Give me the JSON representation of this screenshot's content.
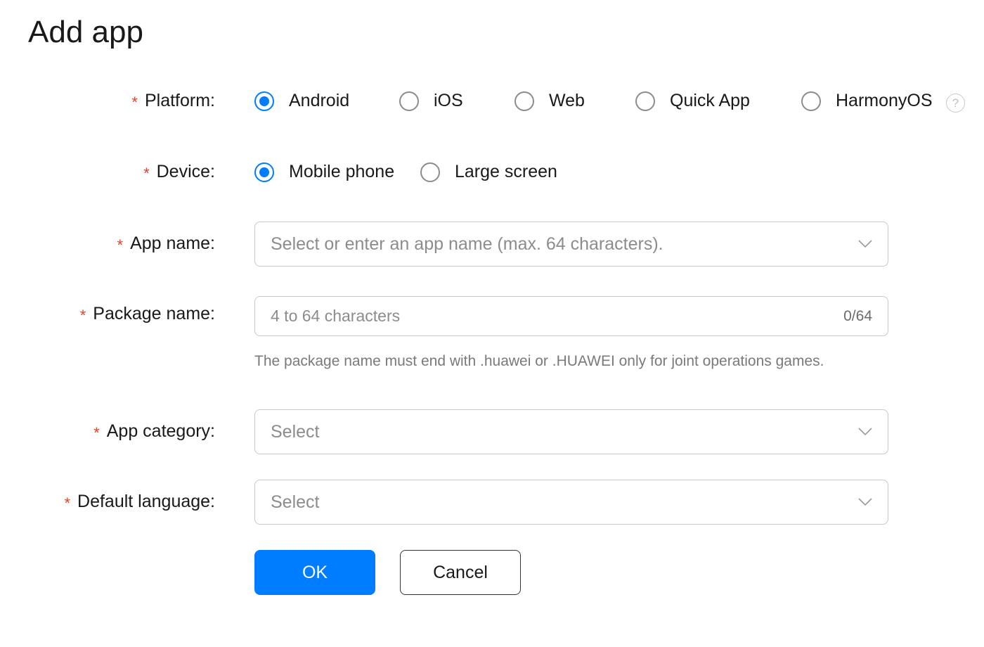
{
  "page": {
    "title": "Add app"
  },
  "required_mark": "*",
  "platform": {
    "label": "Platform:",
    "options": [
      "Android",
      "iOS",
      "Web",
      "Quick App",
      "HarmonyOS"
    ],
    "selected": "Android",
    "help_glyph": "?"
  },
  "device": {
    "label": "Device:",
    "options": [
      "Mobile phone",
      "Large screen"
    ],
    "selected": "Mobile phone"
  },
  "app_name": {
    "label": "App name:",
    "placeholder": "Select or enter an app name (max. 64 characters).",
    "value": ""
  },
  "package_name": {
    "label": "Package name:",
    "placeholder": "4 to 64 characters",
    "value": "",
    "counter": "0/64",
    "hint": "The package name must end with .huawei or .HUAWEI only for joint operations games."
  },
  "app_category": {
    "label": "App category:",
    "placeholder": "Select"
  },
  "default_language": {
    "label": "Default language:",
    "placeholder": "Select"
  },
  "buttons": {
    "ok": "OK",
    "cancel": "Cancel"
  },
  "colors": {
    "accent": "#007dff",
    "required": "#e84026",
    "border": "#c8c8c8"
  },
  "icons": {
    "dropdown": "chevron-down-icon",
    "help": "help-icon"
  }
}
